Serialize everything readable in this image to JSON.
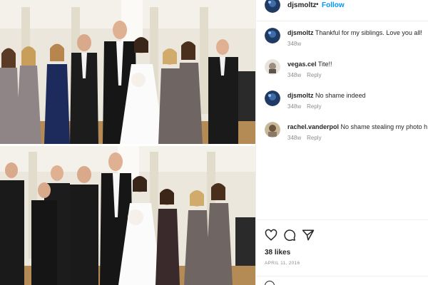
{
  "post": {
    "username": "djsmoltz",
    "separator": "•",
    "follow_label": "Follow"
  },
  "comments": [
    {
      "user": "djsmoltz",
      "text": "Thankful for my siblings. Love you all!",
      "age": "348w",
      "reply": ""
    },
    {
      "user": "vegas.cel",
      "text": "Tite!!",
      "age": "348w",
      "reply": "Reply"
    },
    {
      "user": "djsmoltz",
      "text": "No shame indeed",
      "age": "348w",
      "reply": "Reply"
    },
    {
      "user": "rachel.vanderpol",
      "text": "No shame stealing my photo h",
      "age": "348w",
      "reply": "Reply"
    }
  ],
  "likes_label": "38 likes",
  "date_label": "APRIL 11, 2016",
  "icons": {
    "like": "heart-icon",
    "comment": "comment-icon",
    "share": "share-icon",
    "emoji": "emoji-icon"
  },
  "colors": {
    "link": "#0095f6",
    "muted": "#8e8e8e",
    "text": "#262626",
    "wall": "#ece7dc",
    "navy_dress": "#1d2a5c",
    "grey_dress": "#6f6664"
  }
}
